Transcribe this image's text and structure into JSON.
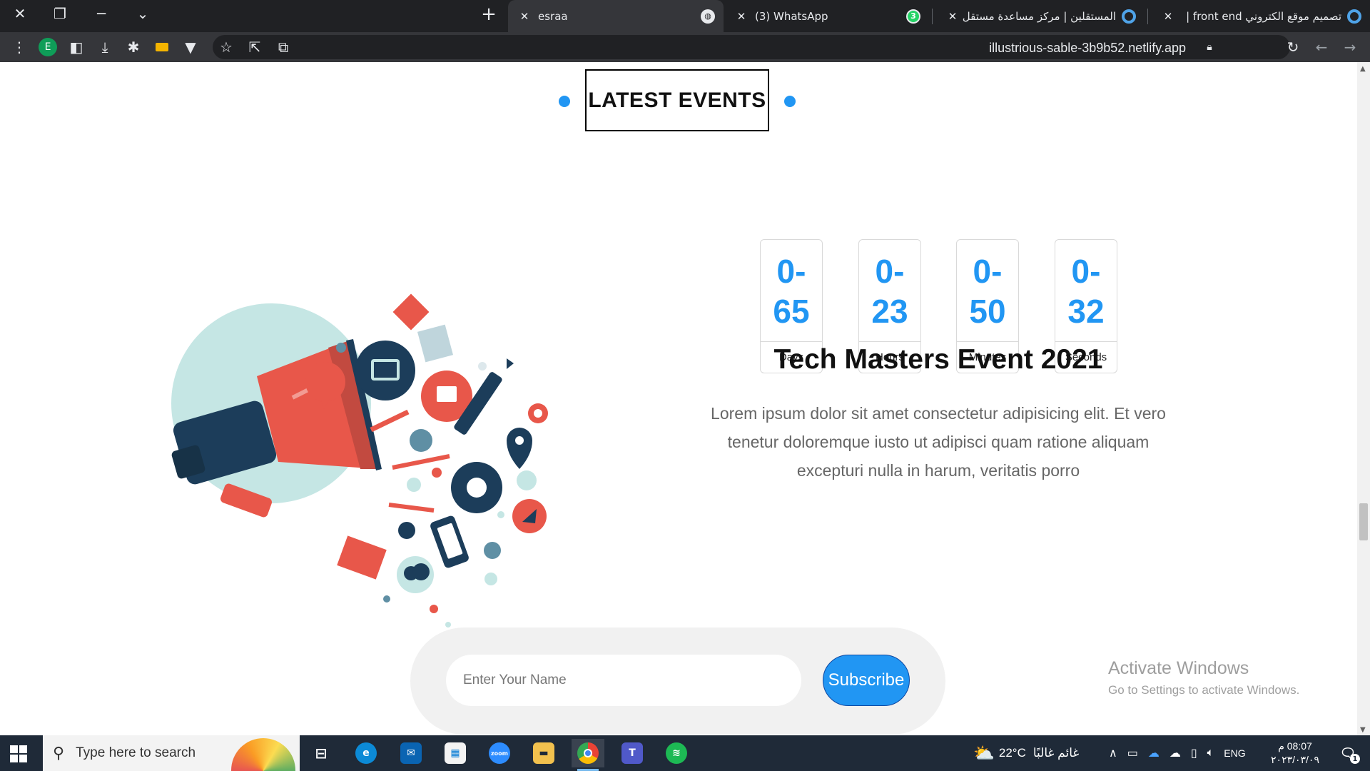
{
  "browser": {
    "tabs": [
      {
        "title": "تصميم موقع الكتروني front end | ",
        "favicon": "mostaql-icon"
      },
      {
        "title": "المستقلين | مركز مساعدة مستقل",
        "favicon": "mostaql-icon"
      },
      {
        "title": "(3) WhatsApp",
        "favicon": "whatsapp-icon",
        "badge": "3"
      },
      {
        "title": "esraa",
        "favicon": "globe-icon",
        "active": true
      }
    ],
    "url": "illustrious-sable-3b9b52.netlify.app",
    "profile_initial": "E"
  },
  "page": {
    "section_title": "LATEST EVENTS",
    "countdown": [
      {
        "value": "0-\n65",
        "label": "Days"
      },
      {
        "value": "0-\n23",
        "label": "Hours"
      },
      {
        "value": "0-\n50",
        "label": "Minutes"
      },
      {
        "value": "0-\n32",
        "label": "Seconds"
      }
    ],
    "event_title": "Tech Masters Event 2021",
    "event_description": "Lorem ipsum dolor sit amet consectetur adipisicing elit. Et vero tenetur doloremque iusto ut adipisci quam ratione aliquam excepturi nulla in harum, veritatis porro",
    "subscribe": {
      "placeholder": "Enter Your Name",
      "button_label": "Subscribe"
    },
    "accent_color": "#2196f3"
  },
  "watermark": {
    "line1": "Activate Windows",
    "line2": "Go to Settings to activate Windows."
  },
  "taskbar": {
    "search_placeholder": "Type here to search",
    "weather_temp": "22°C",
    "weather_text": "غائم غالبًا",
    "language": "ENG",
    "time": "08:07 م",
    "date": "٢٠٢٣/٠٣/٠٩",
    "notification_count": "1"
  }
}
